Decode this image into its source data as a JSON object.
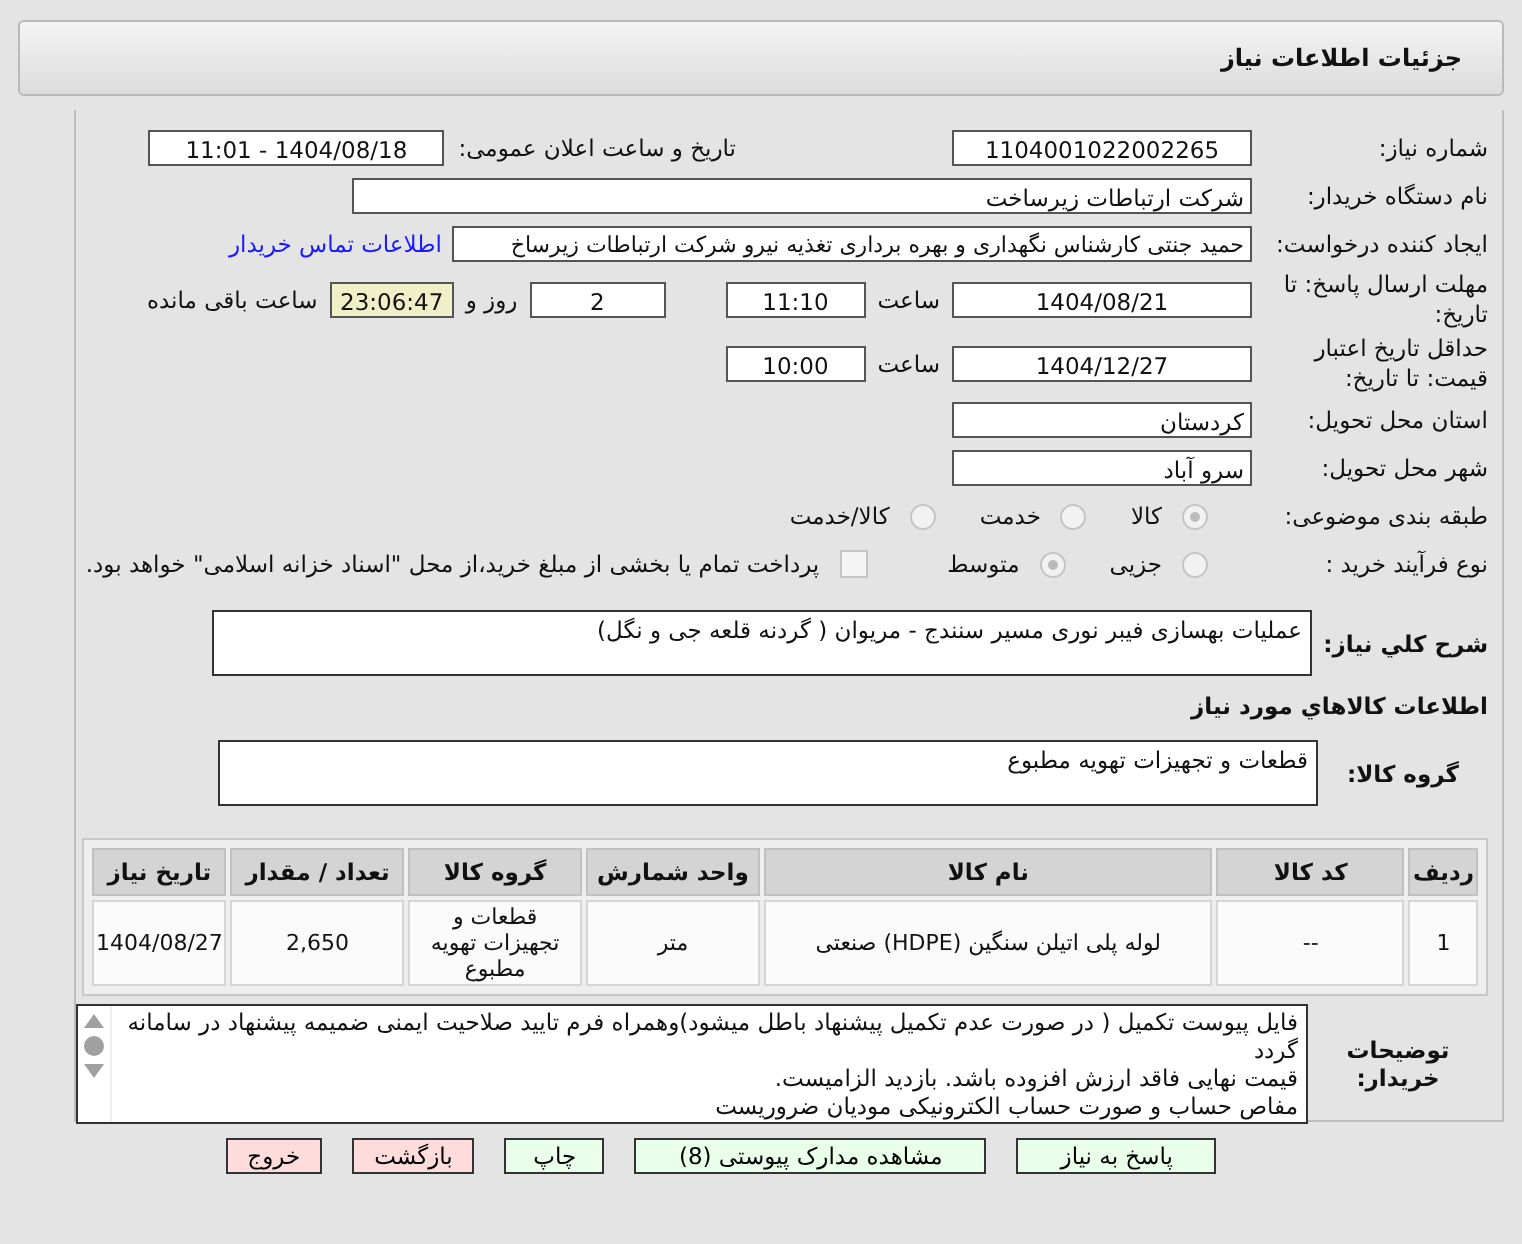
{
  "header": {
    "title": "جزئیات اطلاعات نیاز"
  },
  "need_number": {
    "label": "شماره نیاز:",
    "value": "1104001022002265"
  },
  "announce": {
    "label": "تاریخ و ساعت اعلان عمومی:",
    "value": "1404/08/18 - 11:01"
  },
  "buyer": {
    "label": "نام دستگاه خریدار:",
    "value": "شرکت ارتباطات زیرساخت"
  },
  "requester": {
    "label": "ایجاد کننده درخواست:",
    "value": "حمید جنتی کارشناس نگهداری و بهره برداری تغذیه نیرو شرکت ارتباطات زیرساخ",
    "link": "اطلاعات تماس خریدار"
  },
  "deadline": {
    "label": "مهلت ارسال پاسخ: تا تاریخ:",
    "date": "1404/08/21",
    "time_label": "ساعت",
    "time": "11:10",
    "days": "2",
    "days_label": "روز و",
    "remaining": "23:06:47",
    "remaining_label": "ساعت باقی مانده"
  },
  "validity": {
    "label": "حداقل تاریخ اعتبار قیمت: تا تاریخ:",
    "date": "1404/12/27",
    "time_label": "ساعت",
    "time": "10:00"
  },
  "province": {
    "label": "استان محل تحویل:",
    "value": "کردستان"
  },
  "city": {
    "label": "شهر محل تحویل:",
    "value": "سرو آباد"
  },
  "category": {
    "label": "طبقه بندی موضوعی:",
    "options": [
      {
        "label": "کالا",
        "selected": true
      },
      {
        "label": "خدمت",
        "selected": false
      },
      {
        "label": "کالا/خدمت",
        "selected": false
      }
    ]
  },
  "purchase_type": {
    "label": "نوع فرآیند خرید :",
    "options": [
      {
        "label": "جزیی",
        "selected": false
      },
      {
        "label": "متوسط",
        "selected": true
      }
    ],
    "payment": {
      "checked": false,
      "text": "پرداخت تمام یا بخشی از مبلغ خرید،از محل \"اسناد خزانه اسلامی\" خواهد بود."
    }
  },
  "description": {
    "label": "شرح کلي نياز:",
    "value": "عملیات بهسازی فیبر نوری  مسیر سنندج - مریوان ( گردنه قلعه جی و نگل)"
  },
  "goods_heading": "اطلاعات کالاهاي مورد نياز",
  "goods_group": {
    "label": "گروه کالا:",
    "value": "قطعات و تجهیزات تهویه مطبوع"
  },
  "table": {
    "columns": [
      "ردیف",
      "کد کالا",
      "نام کالا",
      "واحد شمارش",
      "گروه کالا",
      "تعداد / مقدار",
      "تاریخ نیاز"
    ],
    "rows": [
      [
        "1",
        "--",
        "لوله پلی اتیلن سنگین (HDPE) صنعتی",
        "متر",
        "قطعات و تجهیزات تهویه مطبوع",
        "2,650",
        "1404/08/27"
      ]
    ]
  },
  "notes": {
    "label": "توضیحات خریدار:",
    "lines": [
      "فایل پیوست  تکمیل ( در صورت عدم تکمیل پیشنهاد باطل میشود)وهمراه فرم تایید صلاحیت ایمنی ضمیمه پیشنهاد در سامانه گردد",
      "قیمت نهایی فاقد ارزش افزوده  باشد. بازدید الزامیست.",
      "مفاص حساب و صورت حساب الکترونیکی مودیان ضروریست"
    ]
  },
  "buttons": [
    {
      "label": "پاسخ به نیاز",
      "kind": "normal"
    },
    {
      "label": "مشاهده مدارک پیوستی (8)",
      "kind": "normal"
    },
    {
      "label": "چاپ",
      "kind": "normal"
    },
    {
      "label": "بازگشت",
      "kind": "danger"
    },
    {
      "label": "خروج",
      "kind": "danger"
    }
  ]
}
